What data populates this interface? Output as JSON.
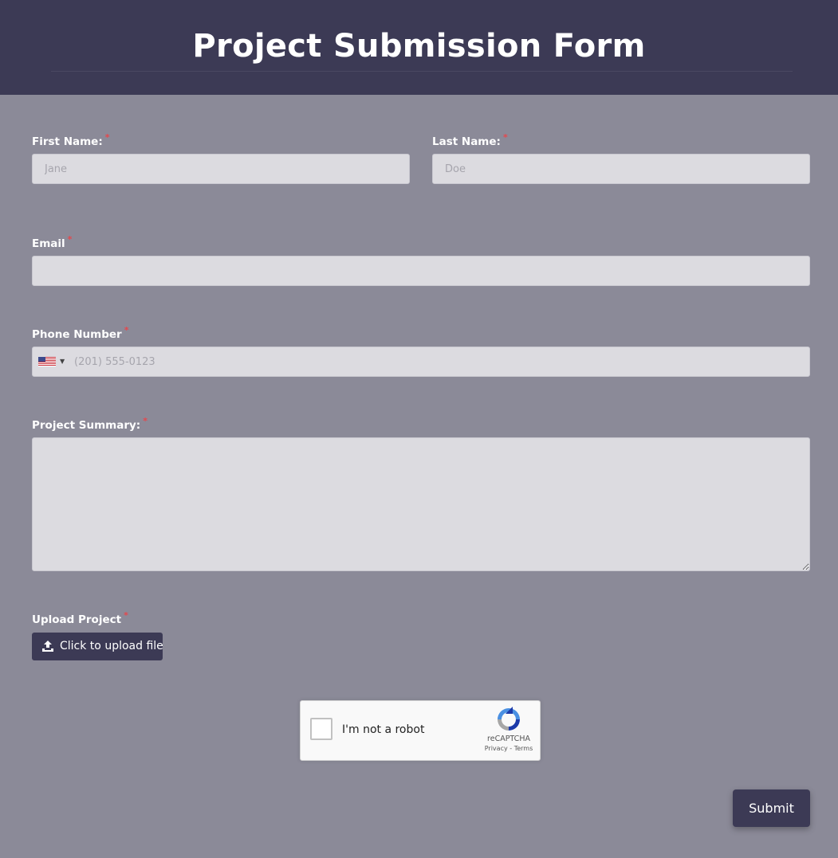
{
  "header": {
    "title": "Project Submission Form"
  },
  "form": {
    "first_name": {
      "label": "First Name:",
      "required": "*",
      "placeholder": "Jane",
      "value": ""
    },
    "last_name": {
      "label": "Last Name:",
      "required": "*",
      "placeholder": "Doe",
      "value": ""
    },
    "email": {
      "label": "Email",
      "required": "*",
      "placeholder": "",
      "value": ""
    },
    "phone": {
      "label": "Phone Number",
      "required": "*",
      "placeholder": "(201) 555-0123",
      "value": "",
      "country_flag_icon": "us-flag-icon"
    },
    "summary": {
      "label": "Project Summary:",
      "required": "*",
      "placeholder": "",
      "value": ""
    },
    "upload": {
      "label": "Upload Project",
      "required": "*",
      "button_label": "Click to upload file",
      "icon": "upload-icon"
    }
  },
  "recaptcha": {
    "checkbox_label": "I'm not a robot",
    "brand": "reCAPTCHA",
    "privacy": "Privacy",
    "separator": " - ",
    "terms": "Terms"
  },
  "submit": {
    "label": "Submit"
  },
  "colors": {
    "header_bg": "#3c3a55",
    "page_bg": "#8b8a98",
    "input_bg": "#dcdbe0",
    "required_mark": "#e5484d",
    "button_bg": "#3c3a55"
  }
}
